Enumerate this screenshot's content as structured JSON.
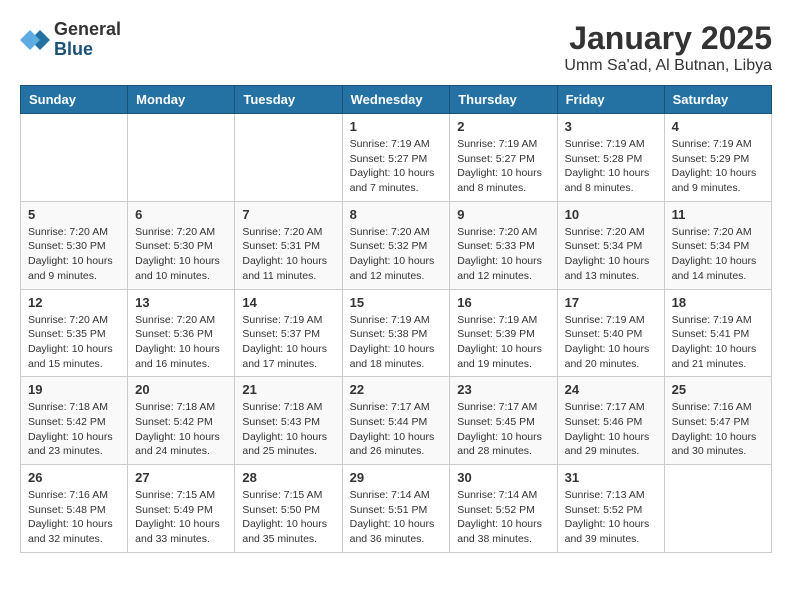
{
  "header": {
    "logo_general": "General",
    "logo_blue": "Blue",
    "month_title": "January 2025",
    "location": "Umm Sa'ad, Al Butnan, Libya"
  },
  "days_of_week": [
    "Sunday",
    "Monday",
    "Tuesday",
    "Wednesday",
    "Thursday",
    "Friday",
    "Saturday"
  ],
  "weeks": [
    [
      {
        "day": "",
        "info": ""
      },
      {
        "day": "",
        "info": ""
      },
      {
        "day": "",
        "info": ""
      },
      {
        "day": "1",
        "info": "Sunrise: 7:19 AM\nSunset: 5:27 PM\nDaylight: 10 hours\nand 7 minutes."
      },
      {
        "day": "2",
        "info": "Sunrise: 7:19 AM\nSunset: 5:27 PM\nDaylight: 10 hours\nand 8 minutes."
      },
      {
        "day": "3",
        "info": "Sunrise: 7:19 AM\nSunset: 5:28 PM\nDaylight: 10 hours\nand 8 minutes."
      },
      {
        "day": "4",
        "info": "Sunrise: 7:19 AM\nSunset: 5:29 PM\nDaylight: 10 hours\nand 9 minutes."
      }
    ],
    [
      {
        "day": "5",
        "info": "Sunrise: 7:20 AM\nSunset: 5:30 PM\nDaylight: 10 hours\nand 9 minutes."
      },
      {
        "day": "6",
        "info": "Sunrise: 7:20 AM\nSunset: 5:30 PM\nDaylight: 10 hours\nand 10 minutes."
      },
      {
        "day": "7",
        "info": "Sunrise: 7:20 AM\nSunset: 5:31 PM\nDaylight: 10 hours\nand 11 minutes."
      },
      {
        "day": "8",
        "info": "Sunrise: 7:20 AM\nSunset: 5:32 PM\nDaylight: 10 hours\nand 12 minutes."
      },
      {
        "day": "9",
        "info": "Sunrise: 7:20 AM\nSunset: 5:33 PM\nDaylight: 10 hours\nand 12 minutes."
      },
      {
        "day": "10",
        "info": "Sunrise: 7:20 AM\nSunset: 5:34 PM\nDaylight: 10 hours\nand 13 minutes."
      },
      {
        "day": "11",
        "info": "Sunrise: 7:20 AM\nSunset: 5:34 PM\nDaylight: 10 hours\nand 14 minutes."
      }
    ],
    [
      {
        "day": "12",
        "info": "Sunrise: 7:20 AM\nSunset: 5:35 PM\nDaylight: 10 hours\nand 15 minutes."
      },
      {
        "day": "13",
        "info": "Sunrise: 7:20 AM\nSunset: 5:36 PM\nDaylight: 10 hours\nand 16 minutes."
      },
      {
        "day": "14",
        "info": "Sunrise: 7:19 AM\nSunset: 5:37 PM\nDaylight: 10 hours\nand 17 minutes."
      },
      {
        "day": "15",
        "info": "Sunrise: 7:19 AM\nSunset: 5:38 PM\nDaylight: 10 hours\nand 18 minutes."
      },
      {
        "day": "16",
        "info": "Sunrise: 7:19 AM\nSunset: 5:39 PM\nDaylight: 10 hours\nand 19 minutes."
      },
      {
        "day": "17",
        "info": "Sunrise: 7:19 AM\nSunset: 5:40 PM\nDaylight: 10 hours\nand 20 minutes."
      },
      {
        "day": "18",
        "info": "Sunrise: 7:19 AM\nSunset: 5:41 PM\nDaylight: 10 hours\nand 21 minutes."
      }
    ],
    [
      {
        "day": "19",
        "info": "Sunrise: 7:18 AM\nSunset: 5:42 PM\nDaylight: 10 hours\nand 23 minutes."
      },
      {
        "day": "20",
        "info": "Sunrise: 7:18 AM\nSunset: 5:42 PM\nDaylight: 10 hours\nand 24 minutes."
      },
      {
        "day": "21",
        "info": "Sunrise: 7:18 AM\nSunset: 5:43 PM\nDaylight: 10 hours\nand 25 minutes."
      },
      {
        "day": "22",
        "info": "Sunrise: 7:17 AM\nSunset: 5:44 PM\nDaylight: 10 hours\nand 26 minutes."
      },
      {
        "day": "23",
        "info": "Sunrise: 7:17 AM\nSunset: 5:45 PM\nDaylight: 10 hours\nand 28 minutes."
      },
      {
        "day": "24",
        "info": "Sunrise: 7:17 AM\nSunset: 5:46 PM\nDaylight: 10 hours\nand 29 minutes."
      },
      {
        "day": "25",
        "info": "Sunrise: 7:16 AM\nSunset: 5:47 PM\nDaylight: 10 hours\nand 30 minutes."
      }
    ],
    [
      {
        "day": "26",
        "info": "Sunrise: 7:16 AM\nSunset: 5:48 PM\nDaylight: 10 hours\nand 32 minutes."
      },
      {
        "day": "27",
        "info": "Sunrise: 7:15 AM\nSunset: 5:49 PM\nDaylight: 10 hours\nand 33 minutes."
      },
      {
        "day": "28",
        "info": "Sunrise: 7:15 AM\nSunset: 5:50 PM\nDaylight: 10 hours\nand 35 minutes."
      },
      {
        "day": "29",
        "info": "Sunrise: 7:14 AM\nSunset: 5:51 PM\nDaylight: 10 hours\nand 36 minutes."
      },
      {
        "day": "30",
        "info": "Sunrise: 7:14 AM\nSunset: 5:52 PM\nDaylight: 10 hours\nand 38 minutes."
      },
      {
        "day": "31",
        "info": "Sunrise: 7:13 AM\nSunset: 5:52 PM\nDaylight: 10 hours\nand 39 minutes."
      },
      {
        "day": "",
        "info": ""
      }
    ]
  ]
}
